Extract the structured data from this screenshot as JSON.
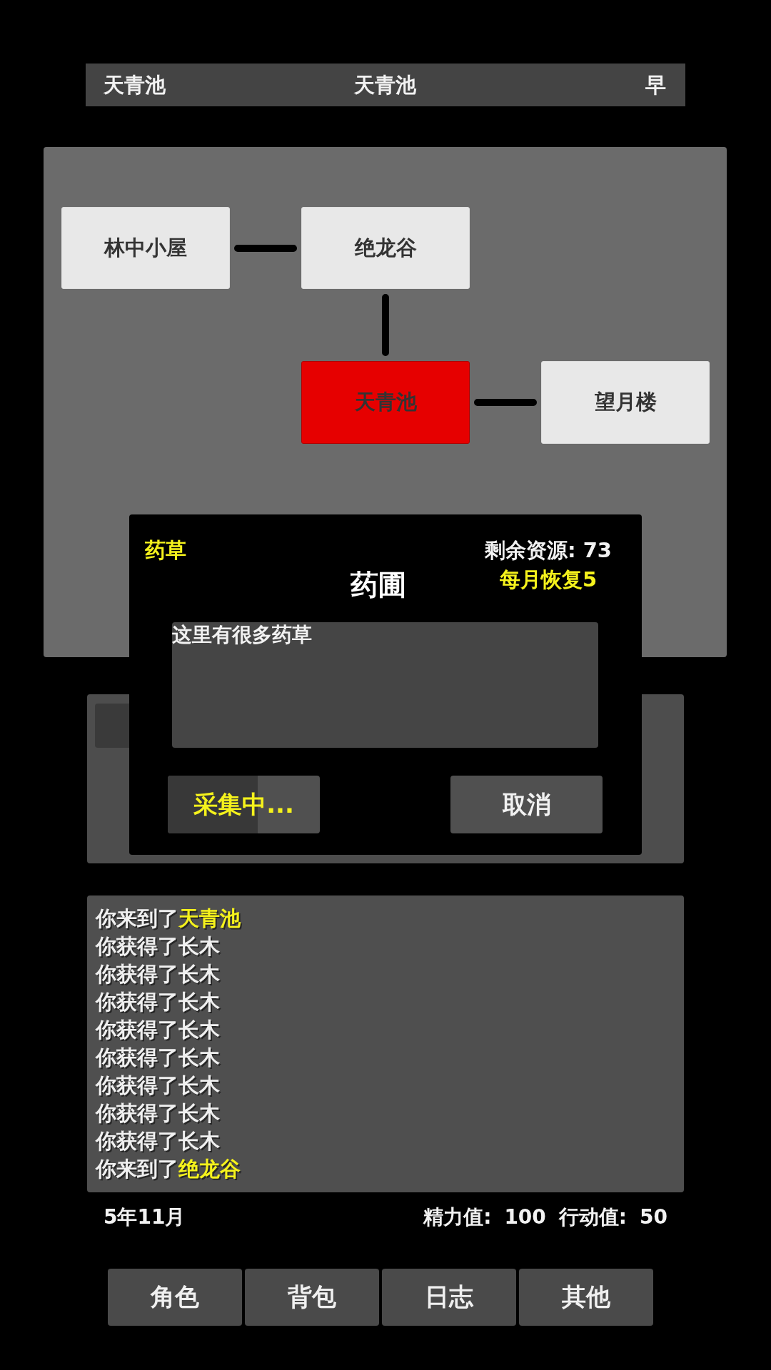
{
  "header": {
    "location": "天青池",
    "title": "天青池",
    "time": "早"
  },
  "map": {
    "nodes": [
      {
        "name": "林中小屋",
        "selected": false
      },
      {
        "name": "绝龙谷",
        "selected": false
      },
      {
        "name": "天青池",
        "selected": true
      },
      {
        "name": "望月楼",
        "selected": false
      }
    ]
  },
  "dialog": {
    "category": "药草",
    "title": "药圃",
    "remaining": "剩余资源: 73",
    "regen": "每月恢复5",
    "description": "这里有很多药草",
    "buttons": [
      {
        "kind": "progress",
        "label": "采集中...",
        "level": 0.59
      },
      {
        "kind": "plain",
        "label": "取消"
      }
    ]
  },
  "log": [
    {
      "text": "你来到了",
      "place": "天青池"
    },
    {
      "text": "你获得了长木"
    },
    {
      "text": "你获得了长木"
    },
    {
      "text": "你获得了长木"
    },
    {
      "text": "你获得了长木"
    },
    {
      "text": "你获得了长木"
    },
    {
      "text": "你获得了长木"
    },
    {
      "text": "你获得了长木"
    },
    {
      "text": "你获得了长木"
    },
    {
      "text": "你来到了",
      "place": "绝龙谷"
    }
  ],
  "status": {
    "date": "5年11月",
    "stats": [
      {
        "label": "精力值:",
        "value": "100"
      },
      {
        "label": "行动值:",
        "value": "50"
      }
    ]
  },
  "nav": [
    "角色",
    "背包",
    "日志",
    "其他"
  ]
}
